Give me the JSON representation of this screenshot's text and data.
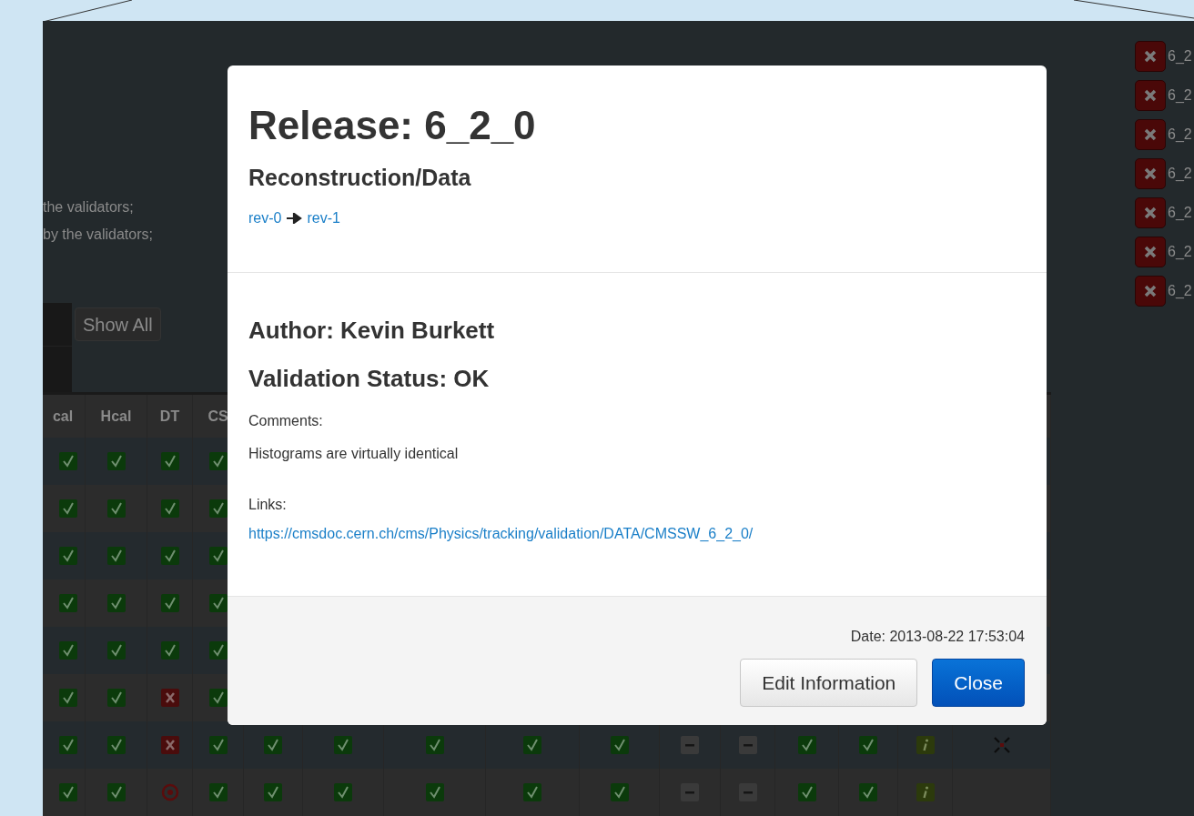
{
  "page": {
    "notes": [
      "the validators;",
      "by the validators;"
    ],
    "show_all_button": "Show All"
  },
  "table": {
    "columns": [
      "cal",
      "Hcal",
      "DT",
      "CS"
    ],
    "rows": [
      {
        "cells": [
          {
            "kind": "ok"
          },
          {
            "kind": "ok"
          },
          {
            "kind": "ok"
          },
          {
            "kind": "ok"
          }
        ]
      },
      {
        "cells": [
          {
            "kind": "ok"
          },
          {
            "kind": "ok"
          },
          {
            "kind": "ok"
          },
          {
            "kind": "ok"
          }
        ]
      },
      {
        "cells": [
          {
            "kind": "ok"
          },
          {
            "kind": "ok"
          },
          {
            "kind": "ok"
          },
          {
            "kind": "ok"
          }
        ]
      },
      {
        "cells": [
          {
            "kind": "ok"
          },
          {
            "kind": "ok"
          },
          {
            "kind": "ok"
          },
          {
            "kind": "ok"
          }
        ]
      },
      {
        "cells": [
          {
            "kind": "ok"
          },
          {
            "kind": "ok"
          },
          {
            "kind": "ok"
          },
          {
            "kind": "ok"
          }
        ]
      },
      {
        "cells": [
          {
            "kind": "ok"
          },
          {
            "kind": "ok"
          },
          {
            "kind": "fail"
          },
          {
            "kind": "ok"
          }
        ]
      },
      {
        "cells": [
          {
            "kind": "ok"
          },
          {
            "kind": "ok"
          },
          {
            "kind": "fail"
          },
          {
            "kind": "ok"
          },
          {
            "kind": "ok"
          },
          {
            "kind": "ok"
          },
          {
            "kind": "ok"
          },
          {
            "kind": "ok"
          },
          {
            "kind": "ok"
          },
          {
            "kind": "na"
          },
          {
            "kind": "na"
          },
          {
            "kind": "ok"
          },
          {
            "kind": "ok"
          },
          {
            "kind": "info"
          },
          {
            "kind": "cross"
          }
        ]
      },
      {
        "cells": [
          {
            "kind": "ok"
          },
          {
            "kind": "ok"
          },
          {
            "kind": "target"
          },
          {
            "kind": "ok"
          },
          {
            "kind": "ok"
          },
          {
            "kind": "ok"
          },
          {
            "kind": "ok"
          },
          {
            "kind": "ok"
          },
          {
            "kind": "ok"
          },
          {
            "kind": "na"
          },
          {
            "kind": "na"
          },
          {
            "kind": "ok"
          },
          {
            "kind": "ok"
          },
          {
            "kind": "info"
          }
        ]
      }
    ]
  },
  "side_list": [
    {
      "label": "6_2"
    },
    {
      "label": "6_2"
    },
    {
      "label": "6_2"
    },
    {
      "label": "6_2"
    },
    {
      "label": "6_2"
    },
    {
      "label": "6_2"
    },
    {
      "label": "6_2"
    }
  ],
  "dialog": {
    "title": "Release: 6_2_0",
    "subtitle": "Reconstruction/Data",
    "revisions": [
      "rev-0",
      "rev-1"
    ],
    "author": "Author: Kevin Burkett",
    "status": "Validation Status: OK",
    "comments_label": "Comments:",
    "comment": "Histograms are virtually identical",
    "links_label": "Links:",
    "link": "https://cmsdoc.cern.ch/cms/Physics/tracking/validation/DATA/CMSSW_6_2_0/",
    "date": "Date: 2013-08-22 17:53:04",
    "buttons": [
      {
        "label": "Edit Information",
        "kind": "default"
      },
      {
        "label": "Close",
        "kind": "primary"
      }
    ]
  }
}
